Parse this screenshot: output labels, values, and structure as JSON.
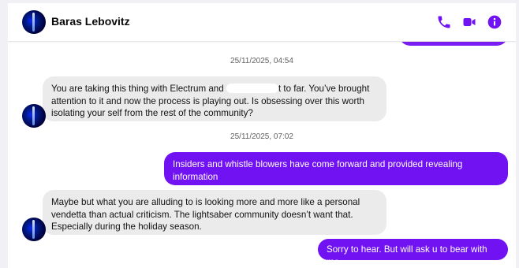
{
  "header": {
    "contact_name": "Baras Lebovitz",
    "icons": [
      "phone-icon",
      "video-icon",
      "info-icon"
    ],
    "accent_color": "#7012f2"
  },
  "messages": [
    {
      "type": "timestamp",
      "text": "25/11/2025, 04:54"
    },
    {
      "type": "incoming",
      "text_before": "You are taking this thing with Electrum and",
      "text_after": "t to far. You’ve brought attention to it and now the process is playing out. Is obsessing over this worth isolating your self from the rest of the community?"
    },
    {
      "type": "timestamp",
      "text": "25/11/2025, 07:02"
    },
    {
      "type": "outgoing",
      "text": "Insiders and whistle blowers have come forward and provided revealing information"
    },
    {
      "type": "incoming",
      "text": "Maybe but what you are alluding to is looking more and more like a personal vendetta than actual criticism. The lightsaber community doesn’t want that. Especially during the holiday season."
    },
    {
      "type": "outgoing",
      "text": "Sorry to hear. But will ask u to bear with me."
    }
  ]
}
